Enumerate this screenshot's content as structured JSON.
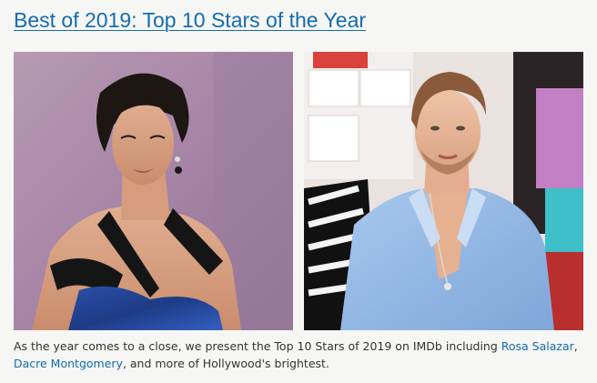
{
  "article": {
    "title": "Best of 2019: Top 10 Stars of the Year",
    "caption_intro": "As the year comes to a close, we present the Top 10 Stars of 2019 on IMDb including ",
    "star_1": "Rosa Salazar",
    "separator": ", ",
    "star_2": "Dacre Montgomery",
    "caption_outro": ", and more of Hollywood's brightest."
  },
  "colors": {
    "link": "#136cb2",
    "text": "#333333",
    "background": "#f6f6f5"
  }
}
